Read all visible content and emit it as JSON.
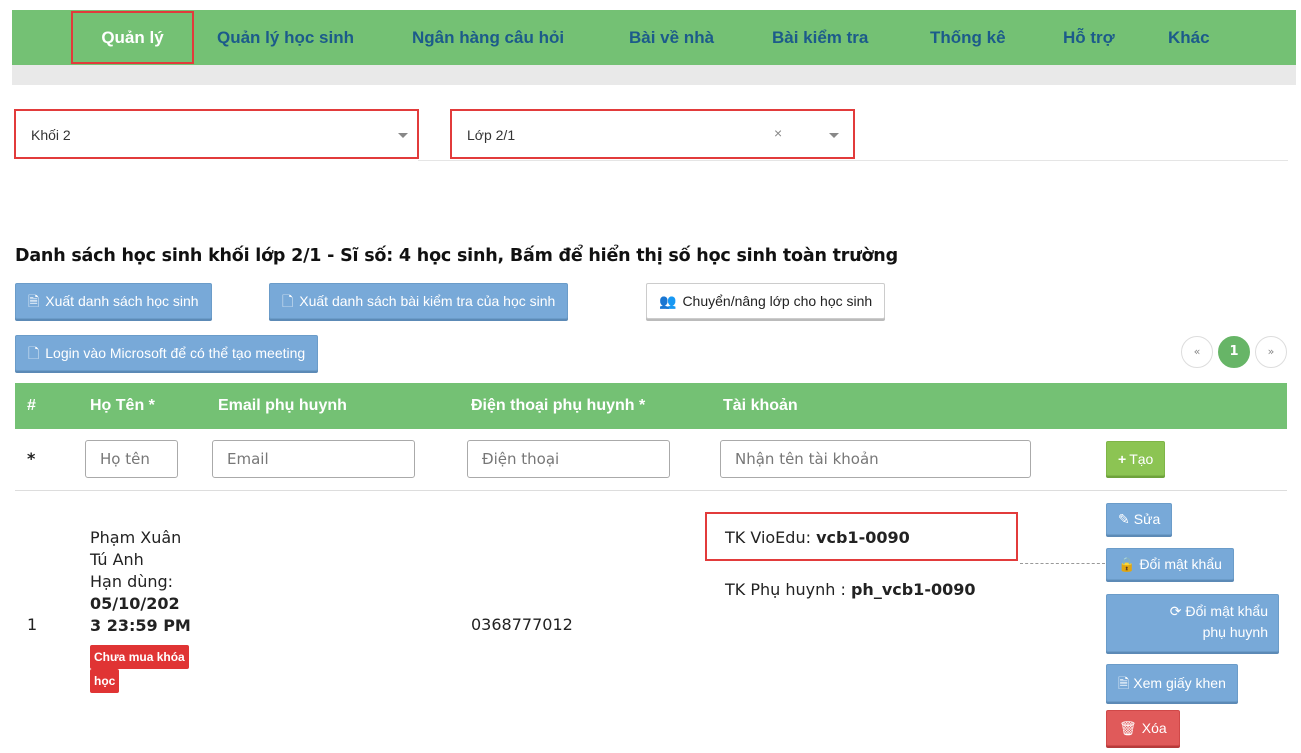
{
  "nav": {
    "items": [
      {
        "label": "Quản lý",
        "active": true
      },
      {
        "label": "Quản lý học sinh"
      },
      {
        "label": "Ngân hàng câu hỏi"
      },
      {
        "label": "Bài về nhà"
      },
      {
        "label": "Bài kiểm tra"
      },
      {
        "label": "Thống kê"
      },
      {
        "label": "Hỗ trợ"
      },
      {
        "label": "Khác"
      }
    ]
  },
  "filters": {
    "grade": "Khối 2",
    "class": "Lớp 2/1",
    "clear_symbol": "×"
  },
  "heading": "Danh sách học sinh khối lớp 2/1 - Sĩ số: 4 học sinh, Bấm để hiển thị số học sinh toàn trường",
  "toolbar": {
    "export_students": "Xuất danh sách học sinh",
    "export_tests": "Xuất danh sách bài kiểm tra của học sinh",
    "move_class": "Chuyển/nâng lớp cho học sinh",
    "login_microsoft": "Login vào Microsoft để có thể tạo meeting"
  },
  "pagination": {
    "prev": "«",
    "current": "1",
    "next": "»"
  },
  "table": {
    "headers": [
      "#",
      "Họ Tên *",
      "Email phụ huynh",
      "Điện thoại phụ huynh *",
      "Tài khoản"
    ],
    "new_row": {
      "marker": "*",
      "name_placeholder": "Họ tên",
      "email_placeholder": "Email",
      "phone_placeholder": "Điện thoại",
      "account_placeholder": "Nhận tên tài khoản",
      "create_label": "Tạo"
    },
    "rows": [
      {
        "index": "1",
        "name_line1": "Phạm Xuân",
        "name_line2": "Tú Anh",
        "expiry_label": "Hạn dùng:",
        "expiry_line1": "05/10/202",
        "expiry_line2": "3 23:59 PM",
        "badge_line1": "Chưa mua khóa",
        "badge_line2": "học",
        "phone": "0368777012",
        "vioedu_label": "TK VioEdu: ",
        "vioedu_account": "vcb1-0090",
        "parent_label": "TK Phụ huynh : ",
        "parent_account": "ph_vcb1-0090",
        "actions": {
          "edit": "Sửa",
          "change_password": "Đổi mật khẩu",
          "change_parent_password_1": "Đổi mật khẩu",
          "change_parent_password_2": "phụ huynh",
          "view_certificate": "Xem giấy khen",
          "delete": "Xóa"
        }
      }
    ]
  },
  "colors": {
    "nav_bg": "#74c174",
    "highlight": "#e23b3b",
    "button_blue": "#78a9d8",
    "button_green": "#8cc453",
    "button_red": "#e05a5a"
  }
}
